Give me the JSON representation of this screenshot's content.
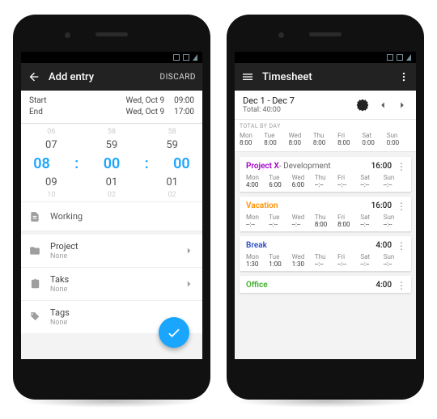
{
  "left": {
    "title": "Add entry",
    "discard": "DISCARD",
    "start_label": "Start",
    "end_label": "End",
    "start_date": "Wed, Oct 9",
    "start_time": "09:00",
    "end_date": "Wed, Oct 9",
    "end_time": "17:00",
    "picker": {
      "r0": [
        "06",
        "58",
        "58"
      ],
      "r1": [
        "07",
        "59",
        "59"
      ],
      "r2": [
        "08",
        ":",
        "00",
        ":",
        "00"
      ],
      "r3": [
        "09",
        "01",
        "01"
      ],
      "r4": [
        "10",
        "02",
        "02"
      ]
    },
    "note_label": "Working",
    "project": {
      "k": "Project",
      "v": "None"
    },
    "tasks": {
      "k": "Taks",
      "v": "None"
    },
    "tags": {
      "k": "Tags",
      "v": "None"
    }
  },
  "right": {
    "title": "Timesheet",
    "range": "Dec 1 - Dec 7",
    "total": "Total: 40:00",
    "total_by_day_label": "TOTAL BY DAY",
    "days": [
      "Mon",
      "Tue",
      "Wed",
      "Thu",
      "Fri",
      "Sat",
      "Sun"
    ],
    "day_totals": [
      "8:00",
      "8:00",
      "8:00",
      "8:00",
      "8:00",
      "0:00",
      "0:00"
    ],
    "cards": [
      {
        "name": "Project X",
        "suffix": " - Development",
        "color": "#a000c8",
        "total": "16:00",
        "hours": [
          "4:00",
          "6:00",
          "6:00",
          "--:--",
          "--:--",
          "--:--",
          "--:--"
        ]
      },
      {
        "name": "Vacation",
        "suffix": "",
        "color": "#ff8f00",
        "total": "16:00",
        "hours": [
          "--:--",
          "--:--",
          "--:--",
          "8:00",
          "8:00",
          "--:--",
          "--:--"
        ]
      },
      {
        "name": "Break",
        "suffix": "",
        "color": "#2d4ec2",
        "total": "4:00",
        "hours": [
          "1:30",
          "1:00",
          "1:30",
          "--:--",
          "--:--",
          "--:--",
          "--:--"
        ]
      },
      {
        "name": "Office",
        "suffix": "",
        "color": "#3fae29",
        "total": "4:00",
        "hours": []
      }
    ]
  }
}
